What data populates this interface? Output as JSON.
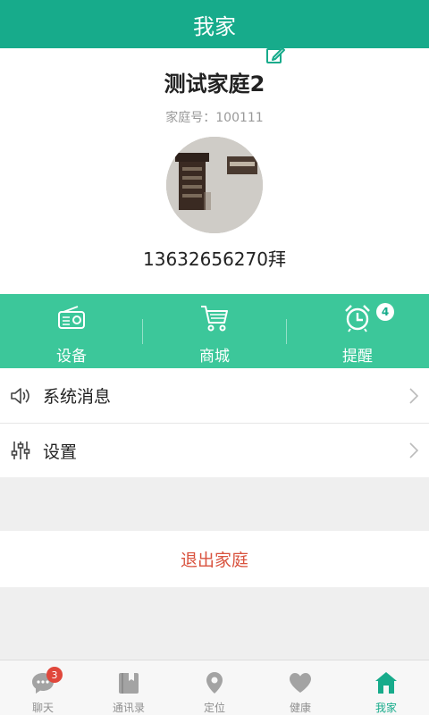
{
  "header": {
    "title": "我家"
  },
  "profile": {
    "family_name": "测试家庭2",
    "family_id_label": "家庭号：",
    "family_id": "100111",
    "phone": "13632656270拜"
  },
  "toolbar": {
    "items": [
      {
        "label": "设备",
        "icon": "radio-icon"
      },
      {
        "label": "商城",
        "icon": "cart-icon"
      },
      {
        "label": "提醒",
        "icon": "alarm-clock-icon",
        "badge": "4"
      }
    ]
  },
  "menu": {
    "items": [
      {
        "label": "系统消息",
        "icon": "speaker-icon"
      },
      {
        "label": "设置",
        "icon": "sliders-icon"
      }
    ]
  },
  "logout": {
    "label": "退出家庭"
  },
  "tabbar": {
    "items": [
      {
        "label": "聊天",
        "icon": "chat-bubble-icon",
        "badge": "3"
      },
      {
        "label": "通讯录",
        "icon": "contacts-book-icon"
      },
      {
        "label": "定位",
        "icon": "location-pin-icon"
      },
      {
        "label": "健康",
        "icon": "heart-icon"
      },
      {
        "label": "我家",
        "icon": "home-icon",
        "active": true
      }
    ]
  },
  "colors": {
    "primary": "#17ab8b",
    "toolbar": "#3cc79a",
    "danger": "#d9533f",
    "badge": "#e0473b"
  }
}
